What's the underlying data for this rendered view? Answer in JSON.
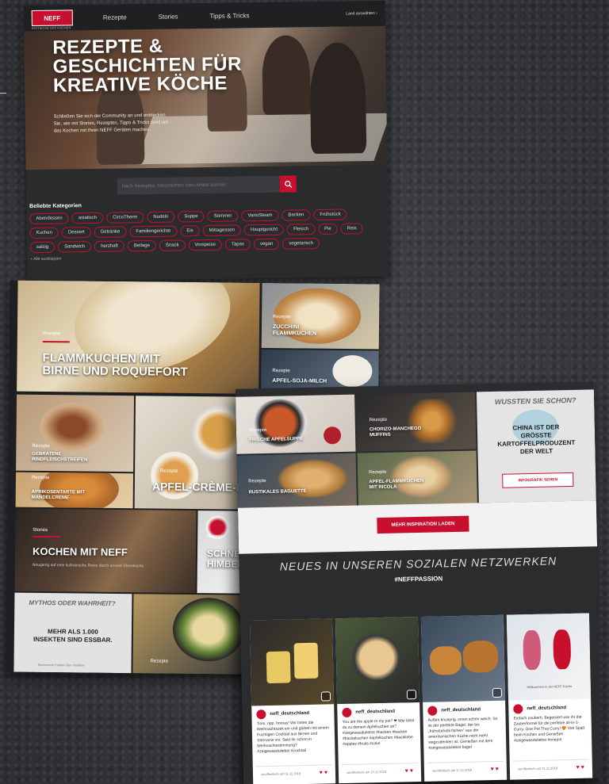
{
  "panel1": {
    "logo": "NEFF",
    "logo_sub": "ENTDECKE DAS KOCHEN",
    "nav": [
      "Rezepte",
      "Stories",
      "Tipps & Tricks"
    ],
    "nav_right": "Land auswählen  ›",
    "hero_title_lines": [
      "REZEPTE &",
      "GESCHICHTEN FÜR",
      "KREATIVE KÖCHE"
    ],
    "hero_text": "Schließen Sie sich der Community an und entdecken Sie, wie mit Stories, Rezepten, Tipps & Tricks rund um das Kochen mit Ihren NEFF Geräten machen.",
    "search_placeholder": "Nach Rezepten, Geschichten oder Artikel suchen",
    "categories_heading": "Beliebte Kategorien",
    "categories": [
      "Abendessen",
      "asiatisch",
      "CircoTherm",
      "Nudeln",
      "Suppe",
      "Sommer",
      "VarioSteam",
      "Backen",
      "Frühstück",
      "Kuchen",
      "Dessert",
      "Getränke",
      "Familiengerichte",
      "Eis",
      "Mittagessen",
      "Hauptgericht",
      "Fleisch",
      "Pie",
      "Reis",
      "salzig",
      "Sandwich",
      "herzhaft",
      "Beilage",
      "Snack",
      "Vorspeise",
      "Tapas",
      "vegan",
      "vegetarisch"
    ],
    "show_all": "+ Alle ausklappen"
  },
  "panel2": {
    "tile1": {
      "category": "Rezepte",
      "title_lines": [
        "FLAMMKUCHEN MIT",
        "BIRNE UND ROQUEFORT"
      ]
    },
    "tile2": {
      "category": "Rezepte",
      "title_lines": [
        "ZUCCHINI",
        "FLAMMKUCHEN"
      ]
    },
    "tile3": {
      "category": "Rezepte",
      "title_lines": [
        "APFEL-SOJA-MILCH"
      ]
    },
    "tile4": {
      "category": "Rezepte",
      "title_lines": [
        "GEBRATENE",
        "RINDFLEISCHSTREIFEN"
      ]
    },
    "tile5": {
      "category": "Rezepte",
      "title_lines": [
        "APRIKOSENTARTE MIT",
        "MANDELCREME"
      ]
    },
    "tile6": {
      "category": "Rezepte",
      "title_lines": [
        "APFEL-CRÈME-B"
      ]
    },
    "tile7": {
      "category": "Stories",
      "title_lines": [
        "KOCHEN MIT NEFF"
      ],
      "subtitle": "Neugierig auf eine kulinarische Reise durch unsere Showküche"
    },
    "tile8": {
      "category": "Rezepte",
      "title_lines": [
        "SCHNEE",
        "HIMBEE"
      ]
    },
    "tile9": {
      "heading": "MYTHOS ODER WAHRHEIT?",
      "title_lines": [
        "MEHR ALS 1.000",
        "INSEKTEN SIND ESSBAR."
      ],
      "footer": "Spannende Fakten über Insekten"
    },
    "tile10": {
      "category": "Rezepte"
    }
  },
  "panel3": {
    "tile1": {
      "category": "Rezepte",
      "title_lines": [
        "FRISCHE APFELSUPPE"
      ]
    },
    "tile2": {
      "category": "Rezepte",
      "title_lines": [
        "CHORIZO-MANCHEGO",
        "MUFFINS"
      ]
    },
    "tile3": {
      "heading": "WUSSTEN SIE SCHON?",
      "title_lines": [
        "CHINA IST DER",
        "GRÖSSTE",
        "KARTOFFELPRODUZENT",
        "DER WELT"
      ],
      "button": "INFOGRAFIK SEHEN"
    },
    "tile4": {
      "category": "Rezepte",
      "title_lines": [
        "RUSTIKALES BAGUETTE"
      ]
    },
    "tile5": {
      "category": "Rezepte",
      "title_lines": [
        "APFEL-FLAMMKUCHEN",
        "MIT RICOLA"
      ]
    },
    "more_button": "MEHR INSPIRATION LADEN",
    "social_title": "NEUES IN UNSEREN SOZIALEN NETZWERKEN",
    "hashtag": "#NEFFPASSION",
    "posts": [
      {
        "user": "neff_deutschland",
        "text": "Tiooi, ripp, hooray! Wir bitten die Weihnachtszeit ein und glühen mit einem fruchtigen Cocktail aus Birnen und Sternanis vor. Seid ihr schon in Weihnachtsstimmung? #zeigewasduliebst #cocktail",
        "date": "veröffentlicht am 01.11.2018"
      },
      {
        "user": "neff_deutschland",
        "text": "You are the apple to my pie? ❤ Wie lässt du zu deinem Apfelkuchen an? #zeigewasduliebst #backen #backen #backekuchen #apfelkuchen #backliebe #apples #fruits #cake",
        "date": "veröffentlicht am 10.11.2018"
      },
      {
        "user": "neff_deutschland",
        "text": "Außen knusprig, innen schön weich: So ist der perfekte Bagel, der bis „frühstücksbrötchen\" aus der amerikanischen Küche nicht mehr wegzudenken ist. Genießen mit dem #zeigewasduliebst bagel",
        "date": "veröffentlicht am 17.11.2018"
      },
      {
        "user": "neff_deutschland",
        "text": "Einfach zauberh. Begeistert war ihr die Zauberformel für die perfekte all-in-1-Curry. One Pot Thai Curry! 😍 Viel Spaß beim Kochen und Genießen #zeigewasduliebst #onepot",
        "date": "veröffentlicht am 21.11.2018",
        "video_label": "Willkommen in der NEFF Küche"
      }
    ]
  },
  "colors": {
    "brand_red": "#c8102e",
    "dark_bg": "#2a2b2d"
  }
}
